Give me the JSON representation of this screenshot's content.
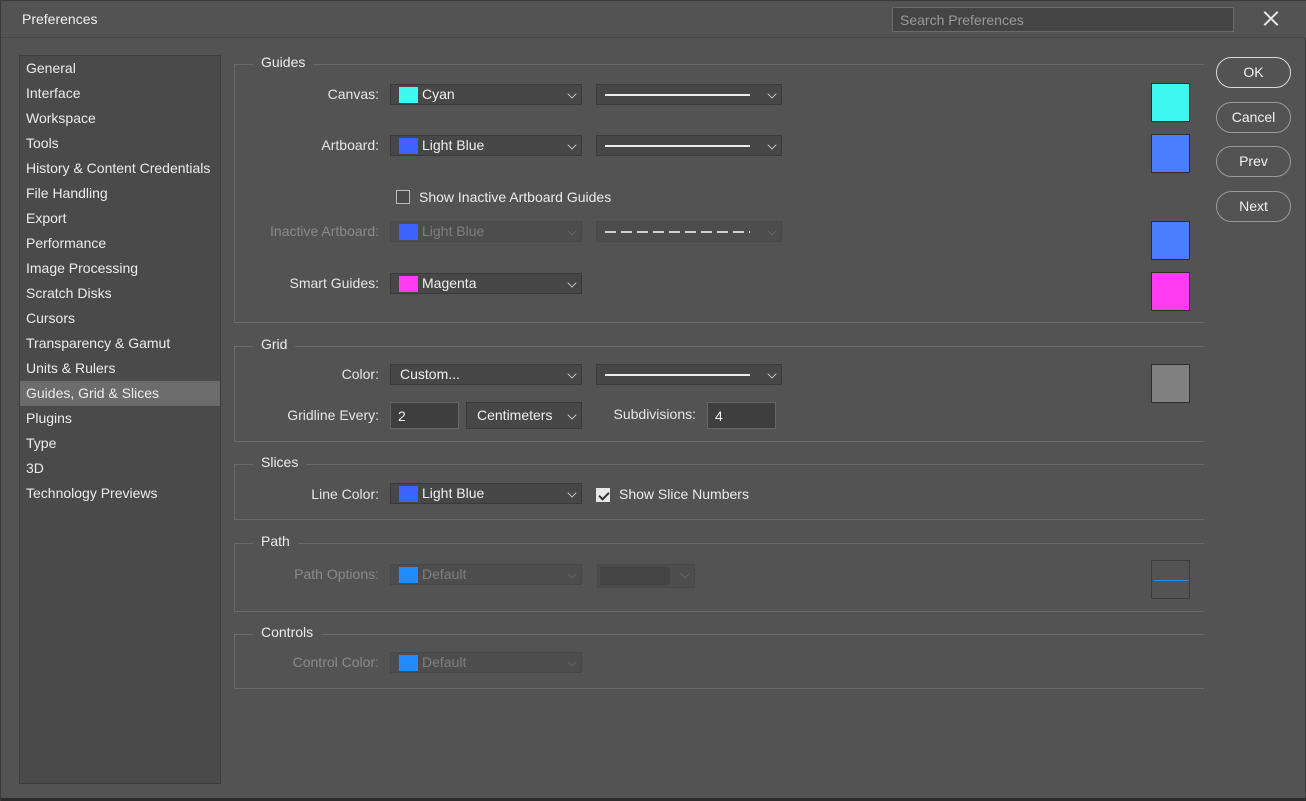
{
  "window": {
    "title": "Preferences",
    "search_placeholder": "Search Preferences"
  },
  "sidebar": {
    "items": [
      {
        "label": "General"
      },
      {
        "label": "Interface"
      },
      {
        "label": "Workspace"
      },
      {
        "label": "Tools"
      },
      {
        "label": "History & Content Credentials"
      },
      {
        "label": "File Handling"
      },
      {
        "label": "Export"
      },
      {
        "label": "Performance"
      },
      {
        "label": "Image Processing"
      },
      {
        "label": "Scratch Disks"
      },
      {
        "label": "Cursors"
      },
      {
        "label": "Transparency & Gamut"
      },
      {
        "label": "Units & Rulers"
      },
      {
        "label": "Guides, Grid & Slices"
      },
      {
        "label": "Plugins"
      },
      {
        "label": "Type"
      },
      {
        "label": "3D"
      },
      {
        "label": "Technology Previews"
      }
    ],
    "active": "Guides, Grid & Slices"
  },
  "guides": {
    "section_title": "Guides",
    "canvas_label": "Canvas:",
    "canvas_color": "Cyan",
    "canvas_hex": "#3ff6f2",
    "artboard_label": "Artboard:",
    "artboard_color": "Light Blue",
    "artboard_hex": "#4a7dff",
    "show_inactive_label": "Show Inactive Artboard Guides",
    "show_inactive_checked": false,
    "inactive_label": "Inactive Artboard:",
    "inactive_color": "Light Blue",
    "inactive_hex": "#4a7dff",
    "smart_label": "Smart Guides:",
    "smart_color": "Magenta",
    "smart_hex": "#ff3cf4"
  },
  "grid": {
    "section_title": "Grid",
    "color_label": "Color:",
    "color_value": "Custom...",
    "color_hex": "#808080",
    "gridline_label": "Gridline Every:",
    "gridline_value": "2",
    "unit_value": "Centimeters",
    "subdivisions_label": "Subdivisions:",
    "subdivisions_value": "4"
  },
  "slices": {
    "section_title": "Slices",
    "line_color_label": "Line Color:",
    "line_color": "Light Blue",
    "line_color_hex": "#3d63ff",
    "show_numbers_label": "Show Slice Numbers",
    "show_numbers_checked": true
  },
  "path": {
    "section_title": "Path",
    "options_label": "Path Options:",
    "options_value": "Default",
    "options_hex": "#1f8cff"
  },
  "controls": {
    "section_title": "Controls",
    "color_label": "Control Color:",
    "color_value": "Default",
    "color_hex": "#1f8cff"
  },
  "buttons": {
    "ok": "OK",
    "cancel": "Cancel",
    "prev": "Prev",
    "next": "Next"
  }
}
